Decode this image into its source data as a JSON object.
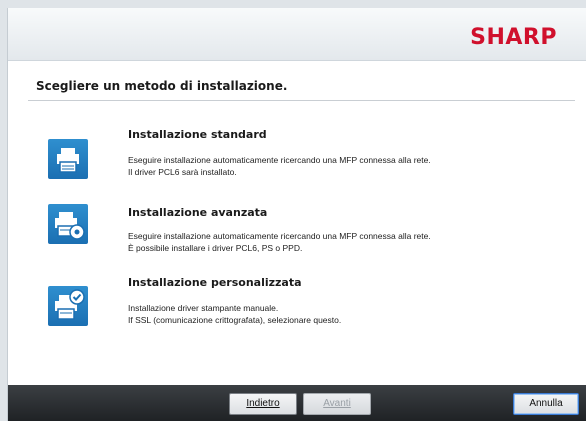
{
  "brand": {
    "logo_text": "SHARP",
    "logo_color": "#d0102c"
  },
  "heading": "Scegliere un metodo di installazione.",
  "options": [
    {
      "title": "Installazione standard",
      "desc_line1": "Eseguire installazione automaticamente ricercando una MFP connessa alla rete.",
      "desc_line2": "Il driver PCL6 sarà installato.",
      "icon": "printer-icon"
    },
    {
      "title": "Installazione avanzata",
      "desc_line1": "Eseguire installazione automaticamente ricercando una MFP connessa alla rete.",
      "desc_line2": "È possibile installare i driver PCL6, PS o PPD.",
      "icon": "printer-gear-icon"
    },
    {
      "title": "Installazione personalizzata",
      "desc_line1": "Installazione driver stampante manuale.",
      "desc_line2": "If SSL (comunicazione crittografata), selezionare questo.",
      "icon": "printer-check-icon"
    }
  ],
  "footer": {
    "back_label": "Indietro",
    "next_label": "Avanti",
    "cancel_label": "Annulla"
  }
}
